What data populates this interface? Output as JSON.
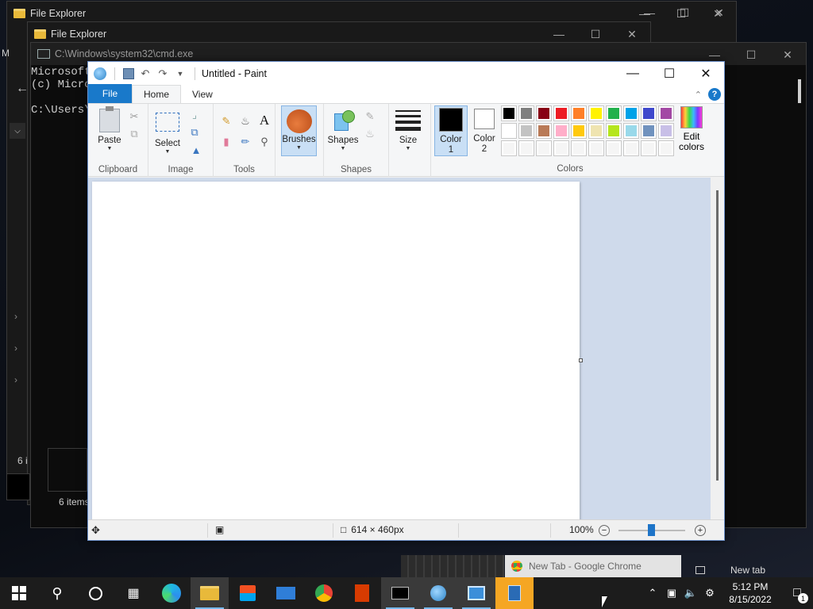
{
  "background_windows": {
    "file_explorer_1": {
      "title": "File Explorer"
    },
    "file_explorer_2": {
      "title": "File Explorer"
    },
    "cmd": {
      "title": "C:\\Windows\\system32\\cmd.exe",
      "lines": [
        "Microsoft",
        "(c) Micro",
        "",
        "C:\\Users\\"
      ]
    },
    "status_items_1": "6 i",
    "status_items_2": "6 items",
    "side_letter": "M"
  },
  "paint": {
    "title": "Untitled - Paint",
    "tabs": {
      "file": "File",
      "home": "Home",
      "view": "View"
    },
    "ribbon": {
      "clipboard": {
        "paste_label": "Paste",
        "group_label": "Clipboard"
      },
      "image": {
        "select_label": "Select",
        "group_label": "Image"
      },
      "tools": {
        "group_label": "Tools"
      },
      "brushes": {
        "label": "Brushes"
      },
      "shapes": {
        "label": "Shapes",
        "group_label": "Shapes"
      },
      "size": {
        "label": "Size"
      },
      "color1": {
        "label_line1": "Color",
        "label_line2": "1"
      },
      "color2": {
        "label_line1": "Color",
        "label_line2": "2"
      },
      "colors": {
        "group_label": "Colors",
        "edit_line1": "Edit",
        "edit_line2": "colors"
      }
    },
    "palette_row1": [
      "#000000",
      "#7f7f7f",
      "#880015",
      "#ed1c24",
      "#ff7f27",
      "#fff200",
      "#22b14c",
      "#00a2e8",
      "#3f48cc",
      "#a349a4"
    ],
    "palette_row2": [
      "#ffffff",
      "#c3c3c3",
      "#b97a57",
      "#ffaec9",
      "#ffc90e",
      "#efe4b0",
      "#b5e61d",
      "#99d9ea",
      "#7092be",
      "#c8bfe7"
    ],
    "palette_row3": [
      "#f5f5f5",
      "#f5f5f5",
      "#f5f5f5",
      "#f5f5f5",
      "#f5f5f5",
      "#f5f5f5",
      "#f5f5f5",
      "#f5f5f5",
      "#f5f5f5",
      "#f5f5f5"
    ],
    "status": {
      "canvas_size": "614 × 460px",
      "zoom": "100%"
    }
  },
  "taskbar": {
    "chrome_preview": "New Tab - Google Chrome",
    "new_tab": "New tab",
    "time": "5:12 PM",
    "date": "8/15/2022",
    "notification_count": "1"
  }
}
